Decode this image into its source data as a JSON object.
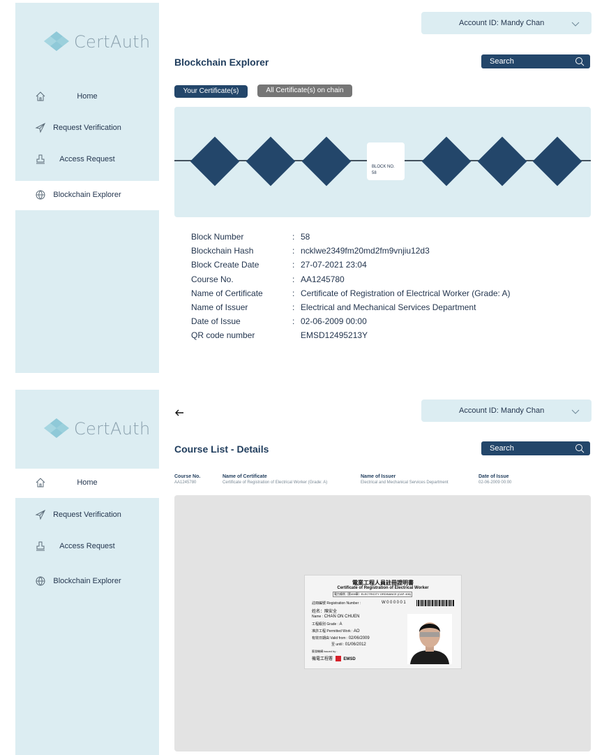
{
  "brand": {
    "name": "CertAuth"
  },
  "nav": [
    "Home",
    "Request Verification",
    "Access Request",
    "Blockchain Explorer"
  ],
  "account": {
    "label": "Account ID: Mandy Chan"
  },
  "screen1": {
    "title": "Blockchain Explorer",
    "search_placeholder": "Search",
    "tab_yours": "Your Certificate(s)",
    "tab_all": "All Certificate(s) on chain",
    "block_label": "BLOCK NO.",
    "block_number": "58",
    "details": [
      {
        "label": "Block Number",
        "sep": ":",
        "value": "58"
      },
      {
        "label": "Blockchain Hash",
        "sep": ":",
        "value": "ncklwe2349fm20md2fm9vnjiu12d3"
      },
      {
        "label": "Block Create Date",
        "sep": ":",
        "value": "27-07-2021 23:04"
      },
      {
        "label": "Course No.",
        "sep": ":",
        "value": "AA1245780"
      },
      {
        "label": "Name of Certificate",
        "sep": ":",
        "value": "Certificate of Registration of Electrical Worker (Grade: A)"
      },
      {
        "label": "Name of Issuer",
        "sep": ":",
        "value": "Electrical and Mechanical Services Department"
      },
      {
        "label": "Date of Issue",
        "sep": ":",
        "value": "02-06-2009 00:00"
      },
      {
        "label": "QR code number",
        "sep": "",
        "value": "EMSD12495213Y"
      }
    ]
  },
  "screen2": {
    "title": "Course List - Details",
    "search_placeholder": "Search",
    "columns": [
      {
        "header": "Course No.",
        "value": "AA1245780"
      },
      {
        "header": "Name of Certificate",
        "value": "Certificate of Registration of Electrical Worker (Grade: A)"
      },
      {
        "header": "Name of Issuer",
        "value": "Electrical and Mechanical Services Department"
      },
      {
        "header": "Date of Issue",
        "value": "02-06-2009 00:00"
      }
    ],
    "card": {
      "title_zh": "電業工程人員註冊證明書",
      "title_en": "Certificate of Registration of Electrical Worker",
      "ordinance": "電力條例（第406章）ELECTRICITY ORDINANCE (CAP. 406)",
      "reg_label": "註冊編號 Registration Number :",
      "reg_value": "W000001",
      "name_zh_label": "姓名：",
      "name_zh": "陳安全",
      "name_label": "Name :",
      "name_value": "CHAN ON CHUEN",
      "grade_label": "工程級別 Grade :",
      "grade_value": "A",
      "work_label": "准許工程 Permitted Work :",
      "work_value": "AO",
      "valid_from_label": "有效日期由 Valid from :",
      "valid_from": "02/06/2009",
      "valid_to_label": "至 until :",
      "valid_to": "01/06/2012",
      "issued_label": "簽發機構 Issued by :",
      "issuer_zh": "機電工程署",
      "issuer_logo": "EMSD"
    }
  },
  "colors": {
    "sidebar": "#dcedf2",
    "navy": "#23466a",
    "gray_pill": "#767676",
    "diamond": "#23466a"
  }
}
